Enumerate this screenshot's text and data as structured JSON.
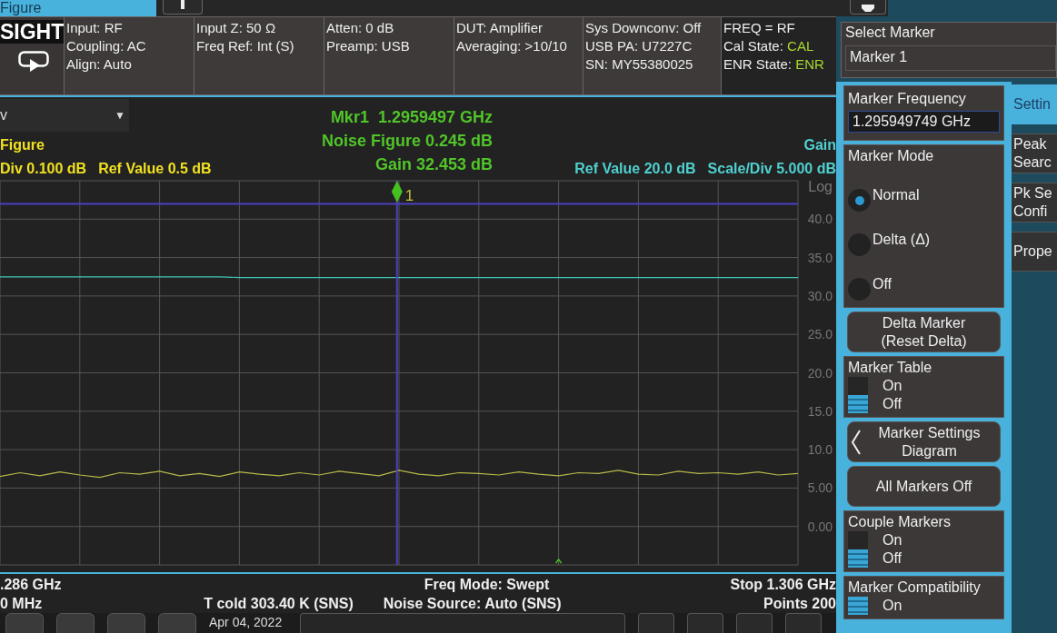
{
  "tabs": [
    {
      "label": "Figure",
      "selected": true
    }
  ],
  "info_bar": {
    "logo": "SIGHT",
    "columns": [
      [
        "Input: RF",
        "Coupling: AC",
        "Align: Auto"
      ],
      [
        "Input Z: 50 Ω",
        "Freq Ref: Int (S)"
      ],
      [
        "Atten: 0 dB",
        "Preamp: USB"
      ],
      [
        "DUT: Amplifier",
        "Averaging: >10/10"
      ],
      [
        "Sys Downconv: Off",
        "USB PA: U7227C",
        "SN: MY55380025"
      ]
    ],
    "status": [
      {
        "label": "FREQ = RF"
      },
      {
        "label": "Cal State: ",
        "value": "CAL"
      },
      {
        "label": "ENR State: ",
        "value": "ENR"
      }
    ]
  },
  "select_marker": {
    "label": "Select Marker",
    "value": "Marker 1"
  },
  "trace_view": {
    "dropdown": "v",
    "dropdown_arrow": "▼",
    "left_scale": [
      "Div 0.100 dB",
      "Ref Value 0.5 dB"
    ],
    "marker_readout": [
      "Mkr1  1.2959497 GHz",
      "Noise Figure 0.245 dB",
      "Gain 32.453 dB"
    ],
    "right_scale": [
      "Ref Value 20.0 dB",
      "Scale/Div 5.000 dB"
    ],
    "axis_unit": "Log",
    "marker_label": "1",
    "chart_data": {
      "type": "line",
      "grid": true,
      "categories": [
        null,
        null,
        null,
        null,
        null,
        null,
        null,
        null,
        null,
        null,
        null,
        null,
        null,
        null,
        null,
        null,
        null,
        null,
        null,
        null,
        null,
        null,
        null,
        null,
        null,
        null,
        null,
        null,
        null,
        null,
        null,
        null,
        null,
        null,
        null,
        null,
        null,
        null,
        null,
        null,
        null
      ],
      "series": [
        {
          "name": "Gain",
          "color": "#3fc8b4",
          "values": [
            32.5,
            32.5,
            32.5,
            32.5,
            32.5,
            32.5,
            32.5,
            32.5,
            32.5,
            32.5,
            32.5,
            32.5,
            32.4,
            32.4,
            32.4,
            32.4,
            32.4,
            32.4,
            32.4,
            32.4,
            32.4,
            32.4,
            32.4,
            32.4,
            32.4,
            32.4,
            32.4,
            32.4,
            32.4,
            32.4,
            32.4,
            32.4,
            32.4,
            32.4,
            32.4,
            32.4,
            32.4,
            32.4,
            32.4,
            32.4,
            32.4
          ]
        },
        {
          "name": "Figure",
          "color": "#b8b84a",
          "values": [
            6.5,
            7.0,
            6.6,
            7.1,
            6.7,
            6.4,
            7.0,
            6.8,
            7.2,
            6.6,
            6.9,
            6.5,
            7.1,
            6.8,
            6.6,
            7.0,
            6.7,
            7.2,
            6.9,
            6.6,
            7.3,
            6.8,
            6.6,
            7.0,
            6.9,
            6.7,
            7.1,
            6.8,
            6.6,
            7.0,
            6.9,
            7.3,
            6.8,
            6.7,
            7.2,
            6.9,
            7.0,
            6.8,
            7.1,
            6.7,
            6.9
          ]
        }
      ],
      "ref_lines": [
        {
          "axis": "y",
          "value": 42,
          "color": "#4b3fc0"
        }
      ],
      "ylim": [
        -5,
        45
      ],
      "yticks": [
        {
          "value": 0,
          "label": "0.00"
        },
        {
          "value": 5,
          "label": "5.00"
        },
        {
          "value": 10,
          "label": "10.0"
        },
        {
          "value": 15,
          "label": "15.0"
        },
        {
          "value": 20,
          "label": "20.0"
        },
        {
          "value": 25,
          "label": "25.0"
        },
        {
          "value": 30,
          "label": "30.0"
        },
        {
          "value": 35,
          "label": "35.0"
        },
        {
          "value": 40,
          "label": "40.0"
        }
      ]
    }
  },
  "status_bar": [
    [
      ".286 GHz",
      "Freq Mode: Swept",
      "Stop 1.306 GHz"
    ],
    [
      "0 MHz",
      "T cold 303.40 K (SNS)",
      "Noise Source: Auto (SNS)",
      "Points 200"
    ]
  ],
  "taskbar": {
    "date": "Apr 04, 2022"
  },
  "marker_menu": {
    "frequency": {
      "label": "Marker Frequency",
      "value": "1.295949749 GHz"
    },
    "mode": {
      "label": "Marker Mode",
      "options": [
        {
          "label": "Normal",
          "selected": true
        },
        {
          "label": "Delta (Δ)",
          "selected": false
        },
        {
          "label": "Off",
          "selected": false
        }
      ]
    },
    "items": [
      {
        "kind": "button",
        "lines": [
          "Delta Marker",
          "(Reset Delta)"
        ]
      },
      {
        "kind": "toggle",
        "label": "Marker Table",
        "options": [
          {
            "label": "On",
            "selected": false
          },
          {
            "label": "Off",
            "selected": true
          }
        ]
      },
      {
        "kind": "back_button",
        "lines": [
          "Marker Settings",
          "Diagram"
        ]
      },
      {
        "kind": "button",
        "lines": [
          "All Markers Off"
        ]
      },
      {
        "kind": "toggle",
        "label": "Couple Markers",
        "options": [
          {
            "label": "On",
            "selected": false
          },
          {
            "label": "Off",
            "selected": true
          }
        ]
      },
      {
        "kind": "toggle",
        "label": "Marker Compatibility",
        "options": [
          {
            "label": "On",
            "selected": true
          }
        ]
      }
    ]
  },
  "side_tabs": [
    {
      "lines": [
        "Settin"
      ],
      "selected": true
    },
    {
      "lines": [
        "Peak",
        "Searc"
      ],
      "selected": false
    },
    {
      "lines": [
        "Pk Se",
        "Confi"
      ],
      "selected": false
    },
    {
      "lines": [
        "Prope"
      ],
      "selected": false
    }
  ]
}
